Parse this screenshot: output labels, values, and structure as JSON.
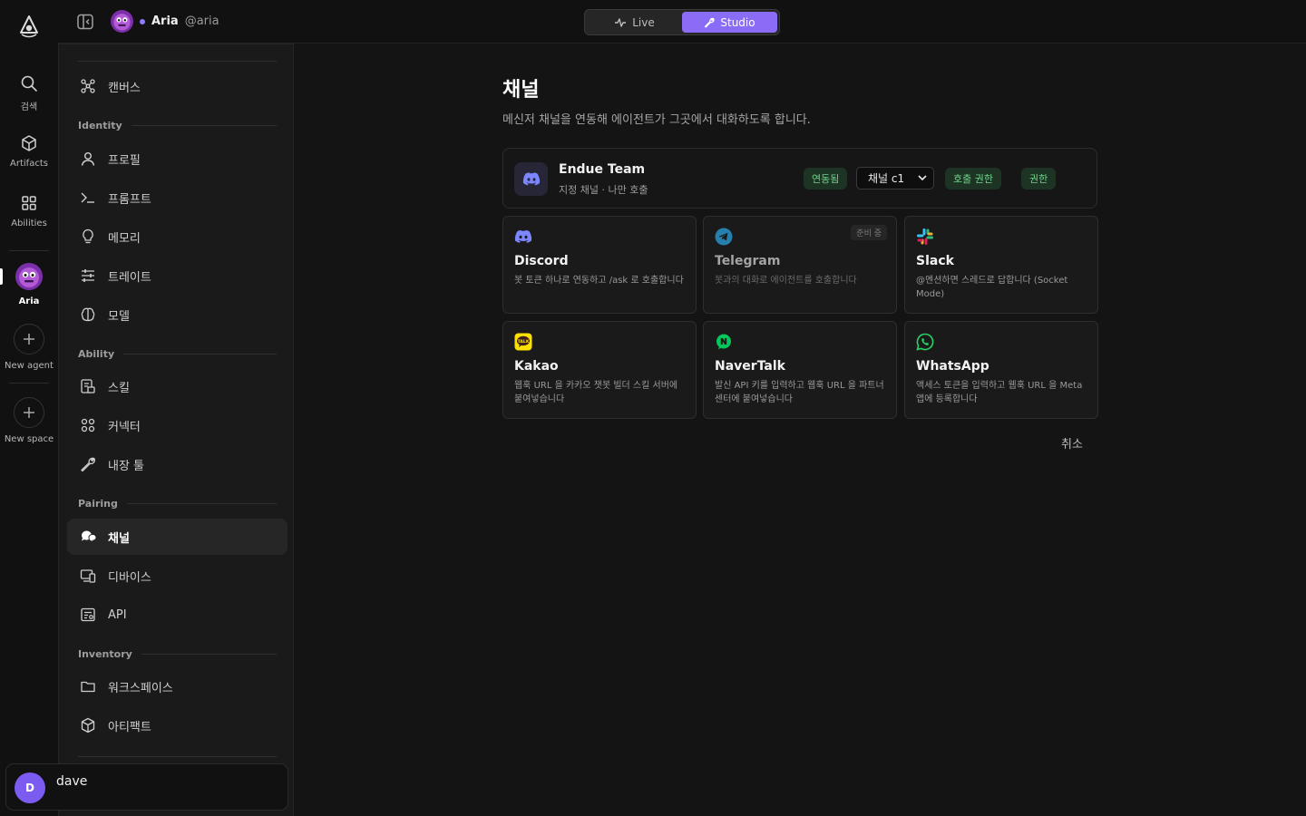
{
  "topbar": {
    "agent_name": "Aria",
    "agent_handle": "@aria",
    "modes": [
      {
        "label": "Live",
        "active": false
      },
      {
        "label": "Studio",
        "active": true
      }
    ]
  },
  "rail": {
    "items": [
      {
        "label": "검색",
        "icon": "search-icon"
      },
      {
        "label": "Artifacts",
        "icon": "cube-icon"
      },
      {
        "label": "Abilities",
        "icon": "grid-icon"
      },
      {
        "label": "Aria",
        "icon": "agent-avatar"
      },
      {
        "label": "New agent",
        "icon": "plus-icon"
      },
      {
        "label": "New space",
        "icon": "plus-icon"
      }
    ]
  },
  "sidebar": {
    "top_item": {
      "label": "캔버스",
      "icon": "canvas-icon"
    },
    "sections": [
      {
        "title": "Identity",
        "items": [
          {
            "label": "프로필",
            "icon": "user-icon"
          },
          {
            "label": "프롬프트",
            "icon": "terminal-icon"
          },
          {
            "label": "메모리",
            "icon": "lightbulb-icon"
          },
          {
            "label": "트레이트",
            "icon": "sliders-icon"
          },
          {
            "label": "모델",
            "icon": "brain-icon"
          }
        ]
      },
      {
        "title": "Ability",
        "items": [
          {
            "label": "스킬",
            "icon": "skill-icon"
          },
          {
            "label": "커넥터",
            "icon": "connector-icon"
          },
          {
            "label": "내장 툴",
            "icon": "wrench-icon"
          }
        ]
      },
      {
        "title": "Pairing",
        "items": [
          {
            "label": "채널",
            "icon": "chat-icon",
            "active": true
          },
          {
            "label": "디바이스",
            "icon": "devices-icon"
          },
          {
            "label": "API",
            "icon": "api-icon"
          }
        ]
      },
      {
        "title": "Inventory",
        "items": [
          {
            "label": "워크스페이스",
            "icon": "folder-icon"
          },
          {
            "label": "아티팩트",
            "icon": "cube-icon"
          }
        ]
      }
    ],
    "user": {
      "initial": "D",
      "name": "dave"
    }
  },
  "main": {
    "title": "채널",
    "subtitle": "메신저 채널을 연동해 에이전트가 그곳에서 대화하도록 합니다.",
    "connected": {
      "name": "Endue Team",
      "detail": "지정 채널 · 나만 호출",
      "status": "연동됨",
      "channel_select": "채널 c1",
      "call_perm": "호출 권한",
      "perm": "권한"
    },
    "channels": [
      {
        "name": "Discord",
        "desc": "봇 토큰 하나로 연동하고 /ask 로 호출합니다",
        "icon": "discord-icon",
        "enabled": true
      },
      {
        "name": "Telegram",
        "desc": "봇과의 대화로 에이전트를 호출합니다",
        "icon": "telegram-icon",
        "enabled": false,
        "badge": "준비 중"
      },
      {
        "name": "Slack",
        "desc": "@멘션하면 스레드로 답합니다 (Socket Mode)",
        "icon": "slack-icon",
        "enabled": true
      },
      {
        "name": "Kakao",
        "desc": "웹훅 URL 을 카카오 챗봇 빌더 스킬 서버에 붙여넣습니다",
        "icon": "kakao-icon",
        "enabled": true
      },
      {
        "name": "NaverTalk",
        "desc": "발신 API 키를 입력하고 웹훅 URL 을 파트너센터에 붙여넣습니다",
        "icon": "navertalk-icon",
        "enabled": true
      },
      {
        "name": "WhatsApp",
        "desc": "액세스 토큰을 입력하고 웹훅 URL 을 Meta 앱에 등록합니다",
        "icon": "whatsapp-icon",
        "enabled": true
      }
    ],
    "cancel": "취소"
  },
  "colors": {
    "accent": "#8b6cf6",
    "success_text": "#6fd08a",
    "success_bg": "#1d3323",
    "discord": "#7b86ff",
    "telegram": "#2aa3df",
    "kakao": "#fae100",
    "naver": "#03c75a",
    "whatsapp": "#25d366"
  }
}
